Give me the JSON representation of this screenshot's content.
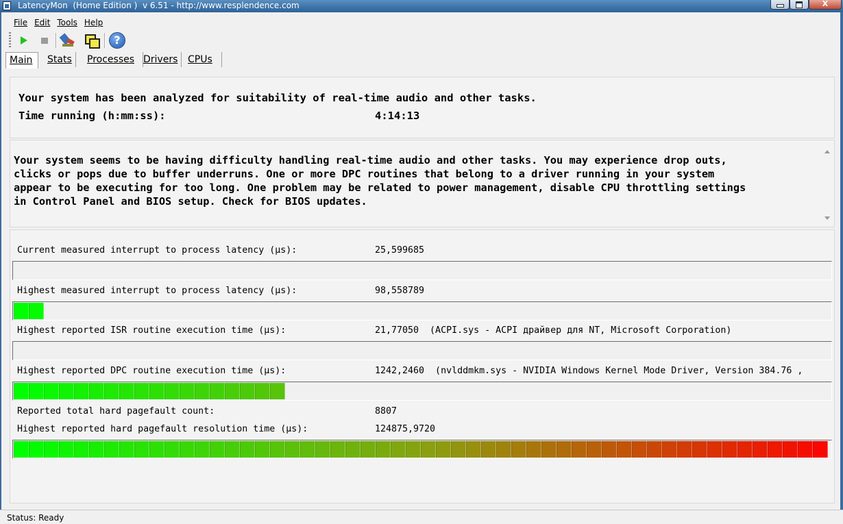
{
  "window": {
    "title": "LatencyMon  (Home Edition )  v 6.51 - http://www.resplendence.com",
    "minimize_label": "",
    "close_label": "X"
  },
  "menu": [
    "File",
    "Edit",
    "Tools",
    "Help"
  ],
  "toolbar": {
    "icons": [
      "play-icon",
      "stop-icon",
      "tools-icon",
      "windows-icon",
      "help-icon"
    ]
  },
  "tabs": [
    "Main",
    "Stats",
    "Processes",
    "Drivers",
    "CPUs"
  ],
  "summary": {
    "line1": "Your system has been analyzed for suitability of real-time audio and other tasks.",
    "time_label": "Time running (h:mm:ss):",
    "time_value": "4:14:13"
  },
  "message": "Your system seems to be having difficulty handling real-time audio and other tasks. You may experience drop outs,\nclicks or pops due to buffer underruns. One or more DPC routines that belong to a driver running in your system\nappear to be executing for too long. One problem may be related to power management, disable CPU throttling settings\nin Control Panel and BIOS setup. Check for BIOS updates.",
  "metrics": [
    {
      "label": "Current measured interrupt to process latency (µs):",
      "value": "25,599685",
      "has_bar": true,
      "bar_level": 0
    },
    {
      "label": "Highest measured interrupt to process latency (µs):",
      "value": "98,558789",
      "has_bar": true,
      "bar_level": 0.033
    },
    {
      "label": "Highest reported ISR routine execution time (µs):",
      "value": "21,77050  (ACPI.sys - ACPI драйвер для NT, Microsoft Corporation)",
      "has_bar": true,
      "bar_level": 0
    },
    {
      "label": "Highest reported DPC routine execution time (µs):",
      "value": "1242,2460  (nvlddmkm.sys - NVIDIA Windows Kernel Mode Driver, Version 384.76 ,",
      "has_bar": true,
      "bar_level": 0.33
    },
    {
      "label": "Reported total hard pagefault count:",
      "value": "8807",
      "has_bar": false
    },
    {
      "label": "Highest reported hard pagefault resolution time (µs):",
      "value": "124875,9720",
      "has_bar": true,
      "bar_level": 1.0
    }
  ],
  "status": "Status: Ready",
  "colors": {
    "bar_start": "#00ff00",
    "bar_mid": "#8aa010",
    "bar_end": "#ff0000",
    "dpc_bar_end": "#4a5e10"
  }
}
